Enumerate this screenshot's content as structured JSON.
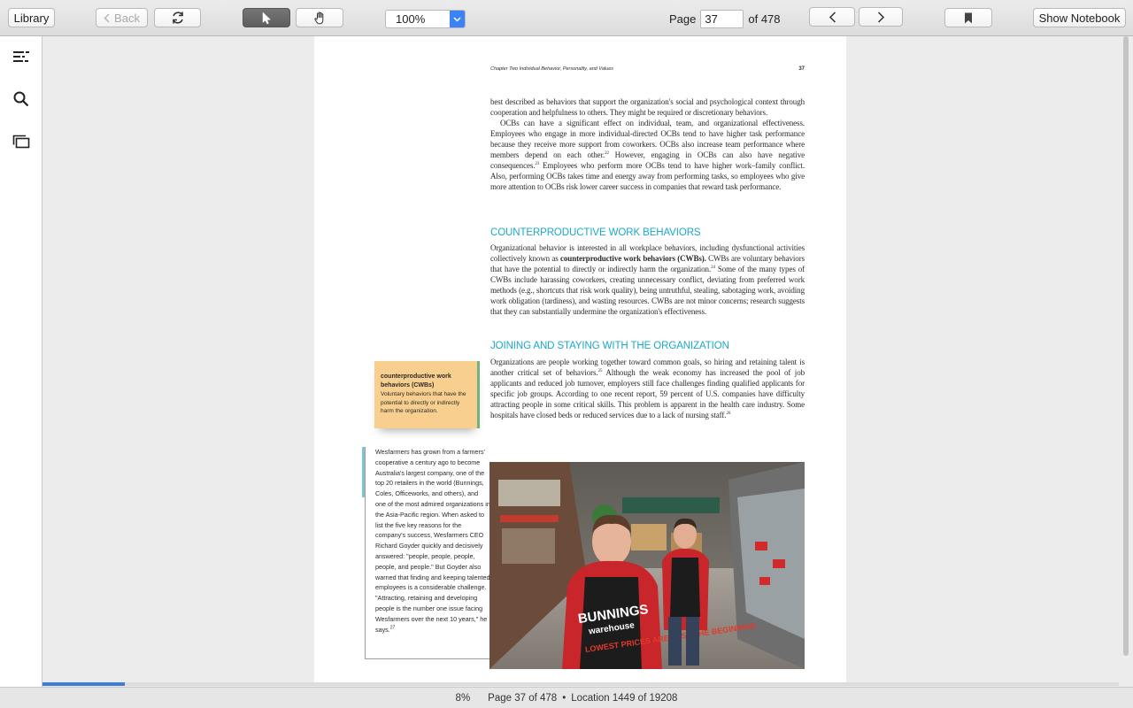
{
  "toolbar": {
    "library_label": "Library",
    "back_label": "Back",
    "zoom_value": "100%",
    "page_label": "Page",
    "page_value": "37",
    "page_of": "of 478",
    "show_notebook_label": "Show Notebook"
  },
  "book": {
    "running_head": "Chapter Two    Individual Behavior, Personality, and Values",
    "page_number": "37",
    "para1": "best described as behaviors that support the organization's social and psychological context through cooperation and helpfulness to others. They might be required or discretionary behaviors.",
    "para2a": "OCBs can have a significant effect on individual, team, and organizational effectiveness. Employees who engage in more individual-directed OCBs tend to have higher task performance because they receive more support from coworkers. OCBs also increase team performance where members depend on each other.",
    "para2_sup1": "22",
    "para2b": " However, engaging in OCBs can also have negative consequences.",
    "para2_sup2": "23",
    "para2c": " Employees who perform more OCBs tend to have higher work–family conflict. Also, performing OCBs takes time and energy away from performing tasks, so employees who give more attention to OCBs risk lower career success in companies that reward task performance.",
    "heading1": "COUNTERPRODUCTIVE WORK BEHAVIORS",
    "para3a": "Organizational behavior is interested in all workplace behaviors, including dysfunctional activities collectively known as ",
    "para3_bold": "counterproductive work behaviors (CWBs).",
    "para3b": " CWBs are voluntary behaviors that have the potential to directly or indirectly harm the organization.",
    "para3_sup": "24",
    "para3c": " Some of the many types of CWBs include harassing coworkers, creating unnecessary conflict, deviating from preferred work methods (e.g., shortcuts that risk work quality), being untruthful, stealing, sabotaging work, avoiding work obligation (tardiness), and wasting resources. CWBs are not minor concerns; research suggests that they can substantially undermine the organization's effectiveness.",
    "heading2": "JOINING AND STAYING WITH THE ORGANIZATION",
    "para4a": "Organizations are people working together toward common goals, so hiring and retaining talent is another critical set of behaviors.",
    "para4_sup1": "25",
    "para4b": " Although the weak economy has increased the pool of job applicants and reduced job turnover, employers still face challenges finding qualified applicants for specific job groups. According to one recent report, 59 percent of U.S. companies have difficulty attracting people in some critical skills. This problem is apparent in the health care industry. Some hospitals have closed beds or reduced services due to a lack of nursing staff.",
    "para4_sup2": "26",
    "term_title": "counterproductive work behaviors (CWBs)",
    "term_def": "Voluntary behaviors that have the potential to directly or indirectly harm the organization.",
    "caption": "Wesfarmers has grown from a farmers' cooperative a century ago to become Australia's largest company, one of the top 20 retailers in the world (Bunnings, Coles, Officeworks, and others), and one of the most admired organizations in the Asia-Pacific region. When asked to list the five key reasons for the company's success, Wesfarmers CEO Richard Goyder quickly and decisively answered: \"people, people, people, people, and people.\" But Goyder also warned that finding and keeping talented employees is a considerable challenge. \"Attracting, retaining and developing people is the number one issue facing Wesfarmers over the next 10 years,\" he says.",
    "caption_sup": "27",
    "apron_text_1": "BUNNINGS",
    "apron_text_2": "warehouse",
    "apron_text_3": "LOWEST PRICES ARE JUST THE BEGINNING"
  },
  "status": {
    "percent": "8%",
    "page_info": "Page 37 of 478",
    "separator": "•",
    "location": "Location 1449 of 19208"
  },
  "progress_fraction": 0.08,
  "icons": [
    "toc-icon",
    "search-icon",
    "flashcards-icon",
    "chevron-left-icon",
    "refresh-icon",
    "cursor-arrow-icon",
    "hand-icon",
    "chevron-down-icon",
    "bookmark-icon"
  ],
  "colors": {
    "heading": "#1aa8c9",
    "term_box": "#f8cf8e",
    "progress": "#3b7dd8",
    "zoom_accent": "#3b82f7"
  }
}
